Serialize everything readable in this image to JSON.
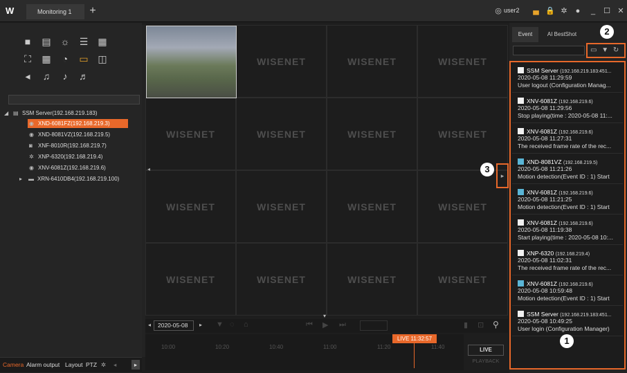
{
  "app": {
    "logo": "W",
    "tab_label": "Monitoring 1",
    "add_tab": "+",
    "user": "user2"
  },
  "left_panel": {
    "tools_row1": [
      "camera-icon",
      "server-icon",
      "sensor-icon",
      "list-icon",
      "table-icon"
    ],
    "tree": [
      {
        "label": "SSM Server(192.168.219.183)",
        "level": 0
      },
      {
        "label": "XND-6081FZ(192.168.219.3)",
        "level": 1,
        "selected": true
      },
      {
        "label": "XND-8081VZ(192.168.219.5)",
        "level": 1
      },
      {
        "label": "XNF-8010R(192.168.219.7)",
        "level": 1
      },
      {
        "label": "XNP-6320(192.168.219.4)",
        "level": 1
      },
      {
        "label": "XNV-6081Z(192.168.219.6)",
        "level": 1
      },
      {
        "label": "XRN-6410DB4(192.168.219.100)",
        "level": 0
      }
    ],
    "bottom_tabs": [
      "Camera",
      "Alarm output",
      "Layout",
      "PTZ"
    ]
  },
  "grid": {
    "watermark": "WISENET"
  },
  "playback": {
    "date": "2020-05-08",
    "live_time": "LIVE 11:32:57",
    "ticks": [
      "10:00",
      "10:20",
      "10:40",
      "11:00",
      "11:20",
      "11:40"
    ],
    "live_btn": "LIVE",
    "playback_btn": "PLAYBACK"
  },
  "right_panel": {
    "tabs": [
      "Event",
      "AI BestShot"
    ],
    "events": [
      {
        "name": "SSM Server",
        "ip": "(192.168.219.183:451...",
        "time": "2020-05-08 11:29:59",
        "desc": "User logout (Configuration Manag...",
        "color": "white"
      },
      {
        "name": "XNV-6081Z",
        "ip": "(192.168.219.6)",
        "time": "2020-05-08 11:29:56",
        "desc": "Stop playing(time : 2020-05-08 11:...",
        "color": "white"
      },
      {
        "name": "XNV-6081Z",
        "ip": "(192.168.219.6)",
        "time": "2020-05-08 11:27:31",
        "desc": "The received frame rate of the rec...",
        "color": "white"
      },
      {
        "name": "XND-8081VZ",
        "ip": "(192.168.219.5)",
        "time": "2020-05-08 11:21:26",
        "desc": "Motion detection(Event ID : 1) Start",
        "color": "blue"
      },
      {
        "name": "XNV-6081Z",
        "ip": "(192.168.219.6)",
        "time": "2020-05-08 11:21:25",
        "desc": "Motion detection(Event ID : 1) Start",
        "color": "blue"
      },
      {
        "name": "XNV-6081Z",
        "ip": "(192.168.219.6)",
        "time": "2020-05-08 11:19:38",
        "desc": "Start playing(time : 2020-05-08 10:...",
        "color": "white"
      },
      {
        "name": "XNP-6320",
        "ip": "(192.168.219.4)",
        "time": "2020-05-08 11:02:31",
        "desc": "The received frame rate of the rec...",
        "color": "white"
      },
      {
        "name": "XNV-6081Z",
        "ip": "(192.168.219.6)",
        "time": "2020-05-08 10:59:48",
        "desc": "Motion detection(Event ID : 1) Start",
        "color": "blue"
      },
      {
        "name": "SSM Server",
        "ip": "(192.168.219.183:451...",
        "time": "2020-05-08 10:49:25",
        "desc": "User login (Configuration Manager)",
        "color": "white"
      }
    ]
  },
  "callouts": {
    "one": "1",
    "two": "2",
    "three": "3"
  },
  "colors": {
    "accent": "#e8682a",
    "motion": "#5ab5d6"
  }
}
